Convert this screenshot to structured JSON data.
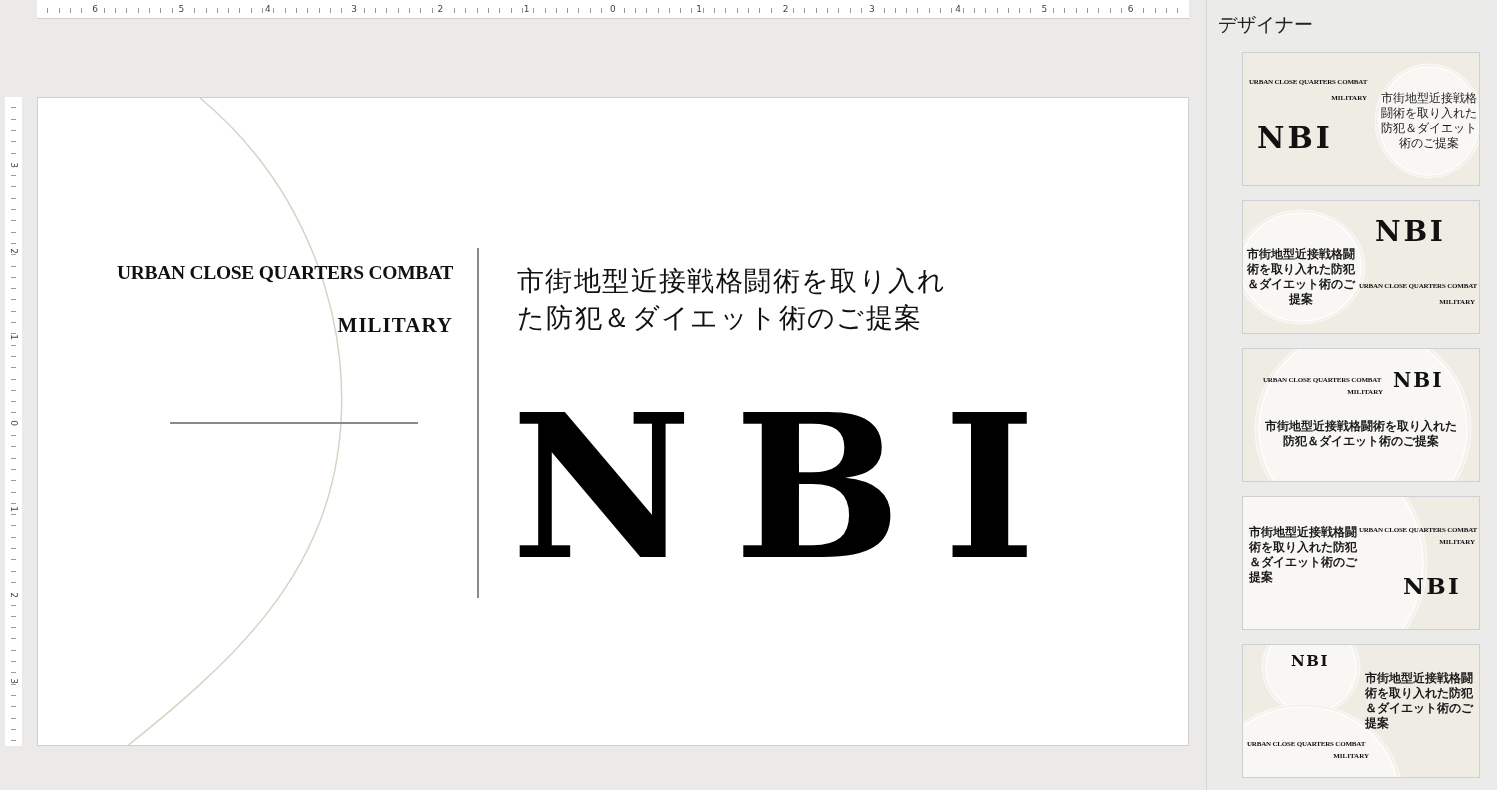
{
  "ruler": {
    "horizontal": [
      "6",
      "5",
      "4",
      "3",
      "2",
      "1",
      "0",
      "1",
      "2",
      "3",
      "4",
      "5",
      "6"
    ],
    "vertical": [
      "3",
      "2",
      "1",
      "0",
      "1",
      "2",
      "3"
    ]
  },
  "slide": {
    "heading": "URBAN CLOSE QUARTERS COMBAT",
    "tag": "MILITARY",
    "title_lines": [
      "市街地型近接戦格闘術を取り入れ",
      "た防犯＆ダイエット術のご提案"
    ],
    "logo": "NBI"
  },
  "designer": {
    "title": "デザイナー",
    "thumbnails": [
      {
        "kind": "bubble-right",
        "selected": false,
        "heading": "URBAN CLOSE QUARTERS COMBAT",
        "tag": "MILITARY",
        "logo": "NBI",
        "title_lines": [
          "市街地型近接戦格",
          "闘術を取り入れた",
          "防犯＆ダイエット",
          "術のご提案"
        ]
      },
      {
        "kind": "bubble-left",
        "selected": false,
        "heading": "URBAN CLOSE QUARTERS COMBAT",
        "tag": "MILITARY",
        "logo": "NBI",
        "title_lines": [
          "市街地型近接戦格闘",
          "術を取り入れた防犯",
          "＆ダイエット術のご",
          "提案"
        ]
      },
      {
        "kind": "center",
        "selected": false,
        "heading": "URBAN CLOSE QUARTERS COMBAT",
        "tag": "MILITARY",
        "logo": "NBI",
        "title_lines": [
          "市街地型近接戦格闘術を取り入れた",
          "防犯＆ダイエット術のご提案"
        ]
      },
      {
        "kind": "wave-left",
        "selected": false,
        "heading": "URBAN CLOSE QUARTERS COMBAT",
        "tag": "MILITARY",
        "logo": "NBI",
        "title_lines": [
          "市街地型近接戦格闘",
          "術を取り入れた防犯",
          "＆ダイエット術のご",
          "提案"
        ]
      },
      {
        "kind": "two-bubbles",
        "selected": false,
        "heading": "URBAN CLOSE QUARTERS COMBAT",
        "tag": "MILITARY",
        "logo": "NBI",
        "title_lines": [
          "市街地型近接戦格闘",
          "術を取り入れた防犯",
          "＆ダイエット術のご",
          "提案"
        ]
      }
    ]
  }
}
